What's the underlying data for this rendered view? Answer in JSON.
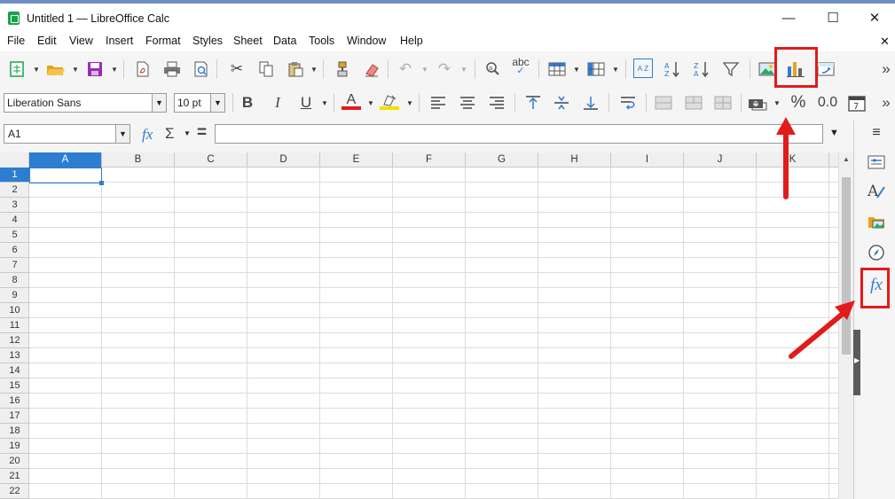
{
  "window": {
    "title": "Untitled 1 — LibreOffice Calc",
    "minimize": "—",
    "maximize": "☐",
    "close": "✕"
  },
  "menu": [
    "File",
    "Edit",
    "View",
    "Insert",
    "Format",
    "Styles",
    "Sheet",
    "Data",
    "Tools",
    "Window",
    "Help"
  ],
  "doc_close": "✕",
  "font": {
    "name": "Liberation Sans",
    "size": "10 pt"
  },
  "format": {
    "bold": "B",
    "italic": "I",
    "underline": "U",
    "font_color": "A",
    "percent": "%",
    "decimal": "0.0"
  },
  "toolbar1": {
    "sort_az": "A Z",
    "spell": "abc",
    "more": "»"
  },
  "toolbar2": {
    "more": "»"
  },
  "namebox": {
    "value": "A1"
  },
  "formula": {
    "fx": "fx",
    "sum": "Σ",
    "equals": "=",
    "value": ""
  },
  "columns": [
    "A",
    "B",
    "C",
    "D",
    "E",
    "F",
    "G",
    "H",
    "I",
    "J",
    "K"
  ],
  "rows": [
    "1",
    "2",
    "3",
    "4",
    "5",
    "6",
    "7",
    "8",
    "9",
    "10",
    "11",
    "12",
    "13",
    "14",
    "15",
    "16",
    "17",
    "18",
    "19",
    "20",
    "21",
    "22"
  ],
  "selected": {
    "column": "A",
    "row": "1"
  },
  "sidebar": {
    "menu": "≡",
    "functions": "fx"
  },
  "colors": {
    "accent": "#2d7dd1",
    "annotation": "#e21b1b",
    "font_color_bar": "#e21b1b",
    "highlight_bar": "#f0e000"
  },
  "icons": [
    "new-spreadsheet-icon",
    "open-icon",
    "save-icon",
    "export-pdf-icon",
    "print-icon",
    "print-preview-icon",
    "cut-icon",
    "copy-icon",
    "paste-icon",
    "clone-formatting-icon",
    "clear-formatting-icon",
    "undo-icon",
    "redo-icon",
    "find-replace-icon",
    "spelling-icon",
    "row-icon",
    "column-icon",
    "sort-icon",
    "sort-ascending-icon",
    "sort-descending-icon",
    "autofilter-icon",
    "insert-image-icon",
    "insert-chart-icon",
    "pivot-table-icon"
  ]
}
